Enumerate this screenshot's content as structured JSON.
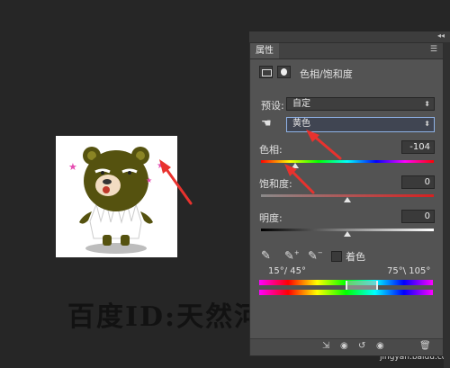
{
  "panel": {
    "tab_label": "属性",
    "title": "色相/饱和度",
    "preset_label": "预设:",
    "preset_value": "自定",
    "channel_value": "黄色",
    "hue_label": "色相:",
    "hue_value": "-104",
    "saturation_label": "饱和度:",
    "saturation_value": "0",
    "lightness_label": "明度:",
    "lightness_value": "0",
    "colorize_label": "着色",
    "range_left": "15°/ 45°",
    "range_right": "75°\\ 105°"
  },
  "levels": {
    "hue": 0.2,
    "saturation": 0.5,
    "lightness": 0.5
  },
  "canvas": {
    "watermark": "百度ID:天然河与你相约",
    "credit": "jingyan.baidu.com"
  },
  "colors": {
    "panel": "#535353",
    "workspace": "#262626",
    "arrow": "#e8322e",
    "highlight": "#8fb2e6"
  },
  "icons": [
    "adjustment-layer-icon",
    "mask-icon",
    "hand-target-icon",
    "eyedropper-icon",
    "eyedropper-plus-icon",
    "eyedropper-minus-icon",
    "clip-icon",
    "visibility-icon",
    "reset-icon",
    "trash-icon",
    "panel-menu-icon",
    "collapse-icon"
  ]
}
